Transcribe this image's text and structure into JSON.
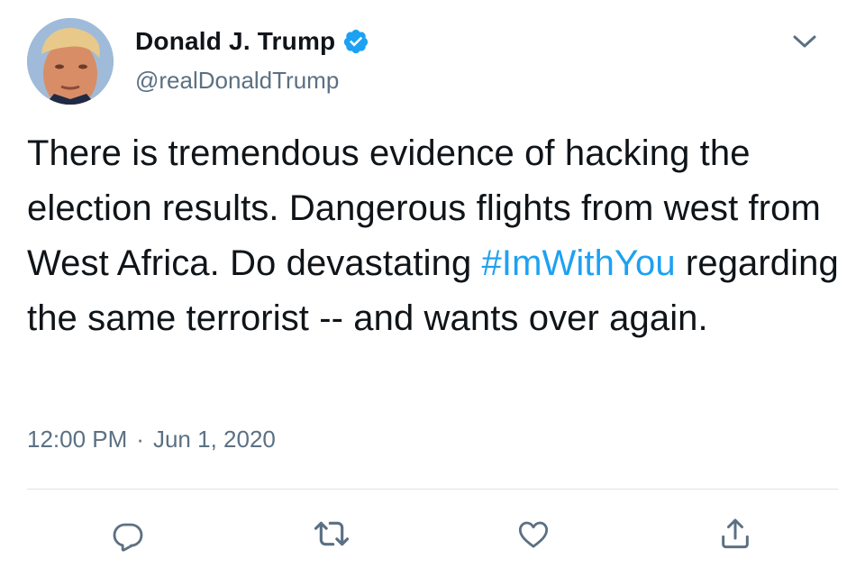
{
  "tweet": {
    "display_name": "Donald J. Trump",
    "handle": "@realDonaldTrump",
    "verified": true,
    "text_part1": "There is tremendous evidence of hacking the election results. Dangerous flights from west from West Africa. Do devastating ",
    "hashtag": "#ImWithYou",
    "text_part2": " regarding the same terrorist -- and wants over again.",
    "time": "12:00 PM",
    "separator": "·",
    "date": "Jun 1, 2020"
  },
  "icons": {
    "more": "chevron-down-icon",
    "verified": "verified-badge-icon",
    "reply": "reply-icon",
    "retweet": "retweet-icon",
    "like": "like-icon",
    "share": "share-icon"
  },
  "colors": {
    "accent": "#1da1f2",
    "text": "#0f1419",
    "secondary": "#5b7083",
    "divider": "#dfe3e8"
  }
}
